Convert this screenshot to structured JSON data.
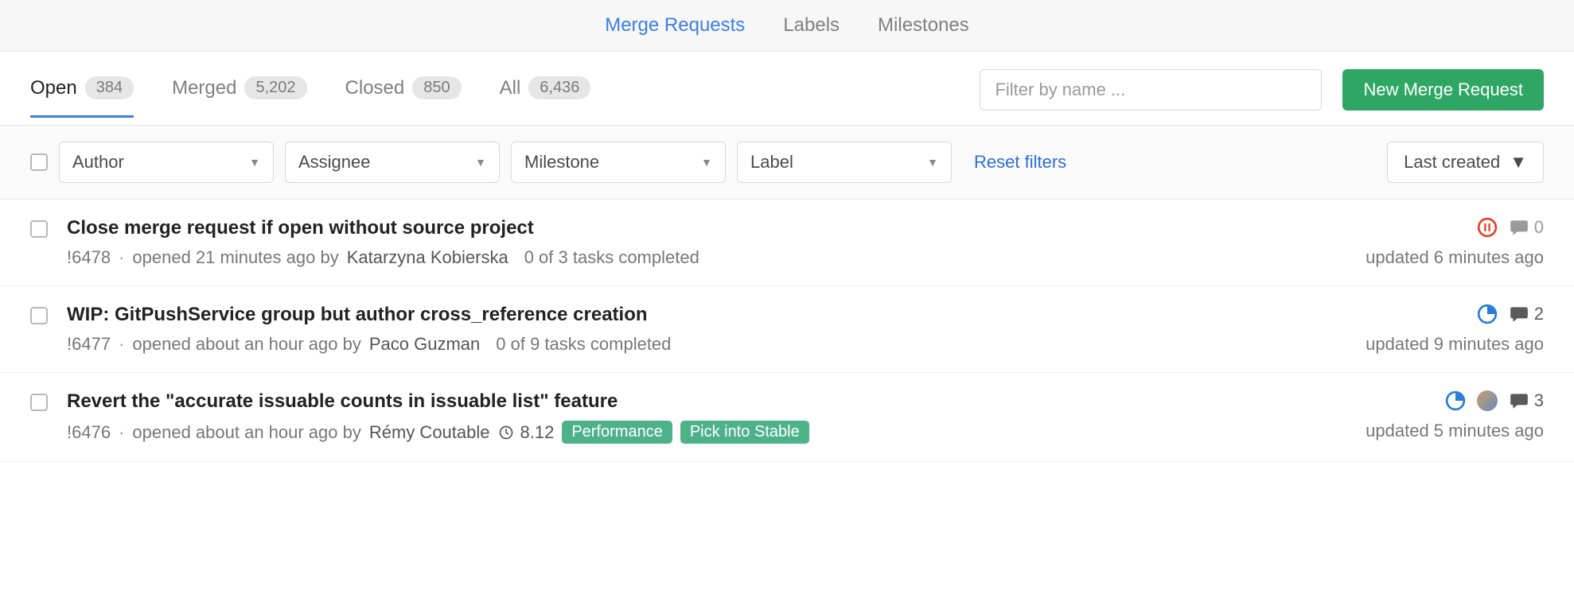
{
  "topnav": {
    "merge_requests": "Merge Requests",
    "labels": "Labels",
    "milestones": "Milestones"
  },
  "state_tabs": {
    "open": {
      "label": "Open",
      "count": "384"
    },
    "merged": {
      "label": "Merged",
      "count": "5,202"
    },
    "closed": {
      "label": "Closed",
      "count": "850"
    },
    "all": {
      "label": "All",
      "count": "6,436"
    }
  },
  "filter_placeholder": "Filter by name ...",
  "new_button": "New Merge Request",
  "filters": {
    "author": "Author",
    "assignee": "Assignee",
    "milestone": "Milestone",
    "label": "Label",
    "reset": "Reset filters",
    "sort": "Last created"
  },
  "rows": [
    {
      "title": "Close merge request if open without source project",
      "ref": "!6478",
      "opened": "opened 21 minutes ago by",
      "author": "Katarzyna Kobierska",
      "tasks": "0 of 3 tasks completed",
      "milestone": "",
      "labels": [],
      "status_icon": "pause-red",
      "avatar": false,
      "comments": "0",
      "comments_zero": true,
      "updated": "updated 6 minutes ago"
    },
    {
      "title": "WIP: GitPushService group but author cross_reference creation",
      "ref": "!6477",
      "opened": "opened about an hour ago by",
      "author": "Paco Guzman",
      "tasks": "0 of 9 tasks completed",
      "milestone": "",
      "labels": [],
      "status_icon": "progress-blue",
      "avatar": false,
      "comments": "2",
      "comments_zero": false,
      "updated": "updated 9 minutes ago"
    },
    {
      "title": "Revert the \"accurate issuable counts in issuable list\" feature",
      "ref": "!6476",
      "opened": "opened about an hour ago by",
      "author": "Rémy Coutable",
      "tasks": "",
      "milestone": "8.12",
      "labels": [
        "Performance",
        "Pick into Stable"
      ],
      "status_icon": "progress-blue",
      "avatar": true,
      "comments": "3",
      "comments_zero": false,
      "updated": "updated 5 minutes ago"
    }
  ]
}
